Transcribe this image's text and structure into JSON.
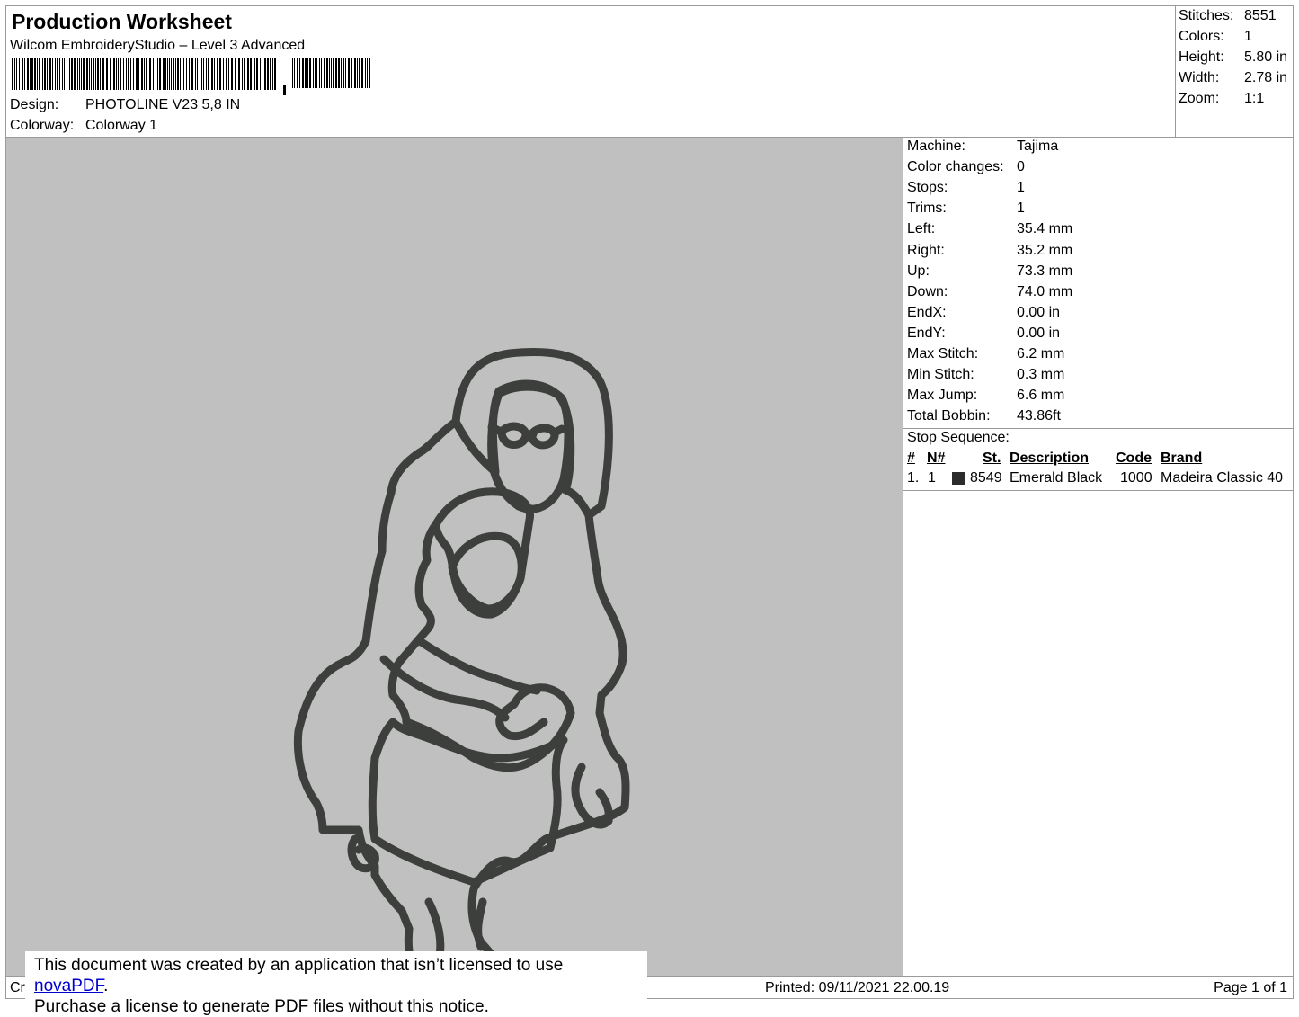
{
  "header": {
    "title": "Production Worksheet",
    "software": "Wilcom EmbroideryStudio – Level 3 Advanced",
    "design_label": "Design:",
    "design_value": "PHOTOLINE V23 5,8 IN",
    "colorway_label": "Colorway:",
    "colorway_value": "Colorway 1"
  },
  "summary": [
    {
      "label": "Stitches:",
      "value": "8551"
    },
    {
      "label": "Colors:",
      "value": "1"
    },
    {
      "label": "Height:",
      "value": "5.80 in"
    },
    {
      "label": "Width:",
      "value": "2.78 in"
    },
    {
      "label": "Zoom:",
      "value": "1:1"
    }
  ],
  "details": [
    {
      "label": "Machine:",
      "value": "Tajima"
    },
    {
      "label": "Color changes:",
      "value": "0"
    },
    {
      "label": "Stops:",
      "value": "1"
    },
    {
      "label": "Trims:",
      "value": "1"
    },
    {
      "label": "Left:",
      "value": "35.4 mm"
    },
    {
      "label": "Right:",
      "value": "35.2 mm"
    },
    {
      "label": "Up:",
      "value": "73.3 mm"
    },
    {
      "label": "Down:",
      "value": "74.0 mm"
    },
    {
      "label": "EndX:",
      "value": "0.00 in"
    },
    {
      "label": "EndY:",
      "value": "0.00 in"
    },
    {
      "label": "Max Stitch:",
      "value": "6.2 mm"
    },
    {
      "label": "Min Stitch:",
      "value": "0.3 mm"
    },
    {
      "label": "Max Jump:",
      "value": "6.6 mm"
    },
    {
      "label": "Total Bobbin:",
      "value": "43.86ft"
    }
  ],
  "stop_sequence": {
    "title": "Stop Sequence:",
    "headers": {
      "num": "#",
      "n": "N#",
      "st": "St.",
      "description": "Description",
      "code": "Code",
      "brand": "Brand"
    },
    "rows": [
      {
        "num": "1.",
        "n": "1",
        "swatch": "#2b2b2b",
        "st": "8549",
        "description": "Emerald Black",
        "code": "1000",
        "brand": "Madeira Classic 40"
      }
    ]
  },
  "preview": {
    "background": "#c0c0c0",
    "thread_color": "#3d3f3c"
  },
  "footer": {
    "left_clip": "Cr",
    "printed": "Printed: 09/11/2021 22.00.19",
    "page": "Page 1 of 1"
  },
  "notice": {
    "line1_prefix": "This document was created by an application that isn’t licensed to use ",
    "link": "novaPDF",
    "line1_suffix": ".",
    "line2": "Purchase a license to generate PDF files without this notice."
  }
}
